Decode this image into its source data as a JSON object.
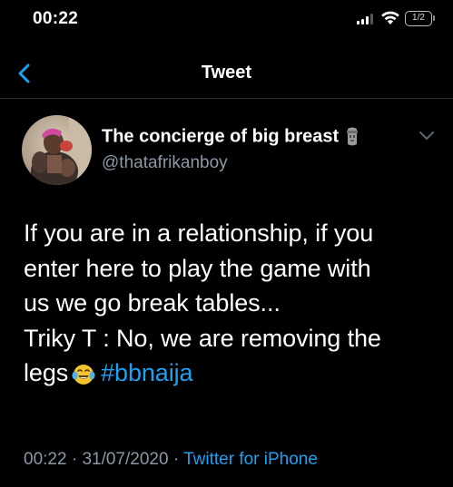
{
  "status_bar": {
    "time": "00:22",
    "badge": "1/2"
  },
  "nav": {
    "title": "Tweet"
  },
  "tweet": {
    "author_name": "The concierge of big breast",
    "author_handle": "@thatafrikanboy",
    "text_lines": [
      "If you are in a relationship, if you",
      "enter here to play the game with",
      "us we go break tables...",
      "Triky T : No, we are removing the",
      "legs"
    ],
    "hashtag": "#bbnaija",
    "time": "00:22",
    "separator": "·",
    "date": "31/07/2020",
    "source": "Twitter for iPhone"
  },
  "colors": {
    "background": "#000000",
    "text": "#ffffff",
    "secondary": "#8b98a5",
    "accent": "#1da1f2"
  },
  "icons": {
    "back": "chevron-left-icon",
    "more": "chevron-down-icon",
    "signal": "cellular-signal-icon",
    "wifi": "wifi-icon",
    "name_emoji": "moai-icon",
    "text_emoji": "laughing-tears-icon"
  }
}
